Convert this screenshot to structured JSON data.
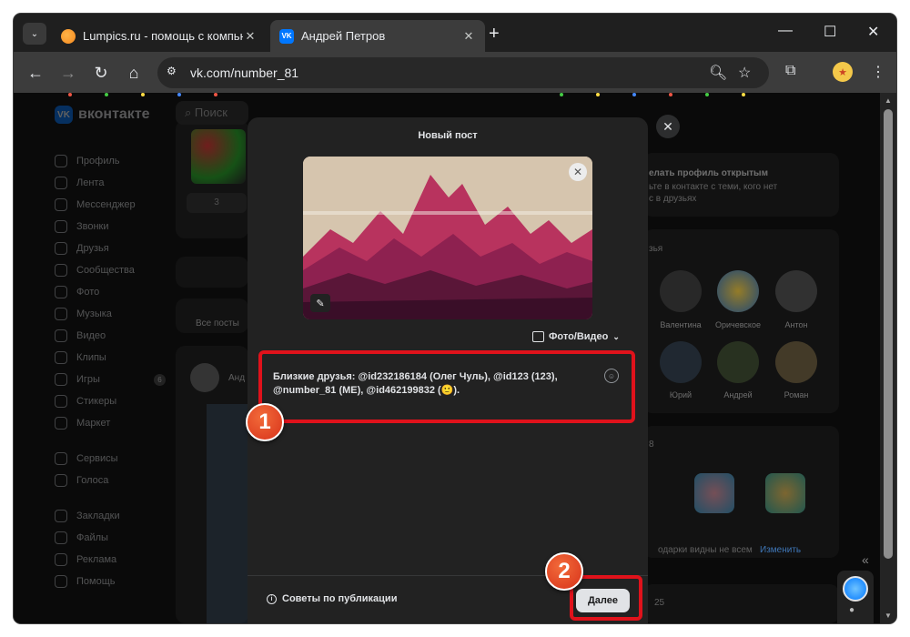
{
  "browser": {
    "tabs": [
      {
        "title": "Lumpics.ru - помощь с компьютером",
        "active": false,
        "favicon": "orange-circle"
      },
      {
        "title": "Андрей Петров",
        "active": true,
        "favicon": "vk-logo"
      }
    ],
    "new_tab": "+",
    "url": "vk.com/number_81",
    "controls": {
      "minimize": "—",
      "maximize": "☐",
      "close": "✕"
    }
  },
  "site": {
    "logo_text": "вконтакте",
    "search_placeholder": "Поиск",
    "sidebar": [
      {
        "label": "Профиль",
        "icon": "profile-icon"
      },
      {
        "label": "Лента",
        "icon": "feed-icon"
      },
      {
        "label": "Мессенджер",
        "icon": "messenger-icon"
      },
      {
        "label": "Звонки",
        "icon": "phone-icon"
      },
      {
        "label": "Друзья",
        "icon": "friends-icon"
      },
      {
        "label": "Сообщества",
        "icon": "communities-icon"
      },
      {
        "label": "Фото",
        "icon": "photo-icon"
      },
      {
        "label": "Музыка",
        "icon": "music-icon"
      },
      {
        "label": "Видео",
        "icon": "video-icon"
      },
      {
        "label": "Клипы",
        "icon": "clips-icon"
      },
      {
        "label": "Игры",
        "icon": "games-icon",
        "badge": "6"
      },
      {
        "label": "Стикеры",
        "icon": "stickers-icon"
      },
      {
        "label": "Маркет",
        "icon": "market-icon"
      },
      {
        "label": "Сервисы",
        "icon": "services-icon"
      },
      {
        "label": "Голоса",
        "icon": "votes-icon"
      },
      {
        "label": "Закладки",
        "icon": "bookmarks-icon"
      },
      {
        "label": "Файлы",
        "icon": "files-icon"
      },
      {
        "label": "Реклама",
        "icon": "ads-icon"
      },
      {
        "label": "Помощь",
        "icon": "help-icon"
      }
    ],
    "background": {
      "all_posts": "Все посты",
      "post_author_fragment": "Анд",
      "open_profile_title": "елать профиль открытым",
      "open_profile_desc_1": "ьте в контакте с теми, кого нет",
      "open_profile_desc_2": "с в друзьях",
      "friends_title_fragment": "зья",
      "friends": [
        "Валентина",
        "Оричевское",
        "Антон",
        "Юрий",
        "Андрей",
        "Роман"
      ],
      "gifts_count_fragment": "8",
      "gifts_note": "одарки видны не всем",
      "gifts_change": "Изменить",
      "followers_count_fragment": "25",
      "small_count": "3"
    }
  },
  "modal": {
    "title": "Новый пост",
    "media_button": "Фото/Видео",
    "post_text_line1": "Близкие друзья: @id232186184 (Олег Чуль), @id123 (123),",
    "post_text_line2": "@number_81 (ME), @id462199832 (🙂).",
    "tips": "Советы по публикации",
    "next_button": "Далее"
  },
  "annotations": {
    "step1": "1",
    "step2": "2",
    "highlight_color": "#e0121b"
  },
  "colors": {
    "page_bg": "#0a0a0a",
    "modal_bg": "#222222",
    "vk_blue": "#0077ff",
    "accent_text": "#e1e3e6"
  }
}
